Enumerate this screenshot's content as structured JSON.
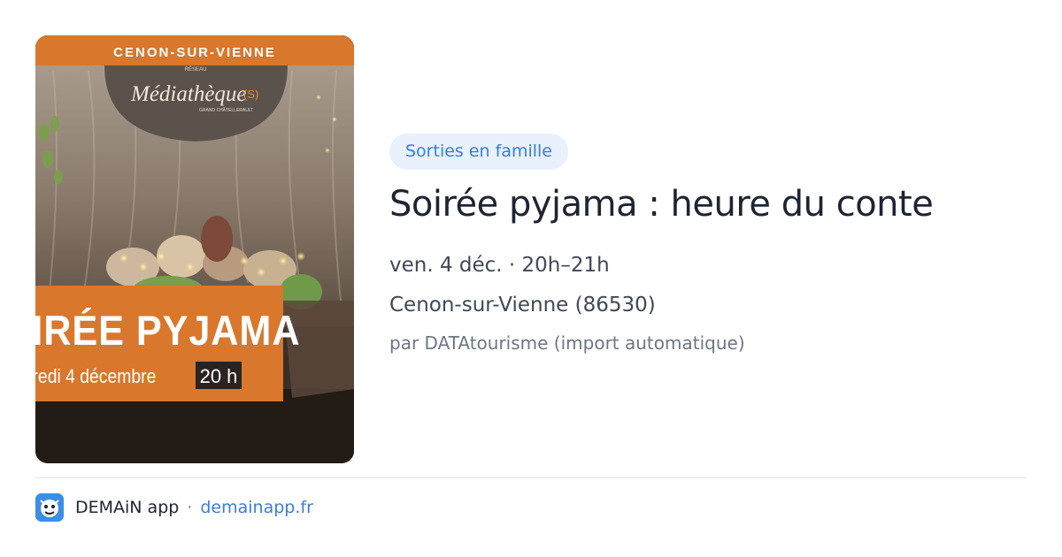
{
  "poster": {
    "town": "CENON-SUR-VIENNE",
    "network": "RÉSEAU",
    "library": "Médiathèque",
    "library_suffix": "(S)",
    "library_sub": "GRAND CHÂTELLERAULT",
    "headline": "IRÉE PYJAMA",
    "date_text": "redi 4 décembre",
    "time_text": "20 h",
    "colors": {
      "orange": "#d9772c",
      "dark_circle": "#5a524b"
    }
  },
  "event": {
    "category": "Sorties en famille",
    "title": "Soirée pyjama : heure du conte",
    "when": "ven. 4 déc. · 20h–21h",
    "where": "Cenon-sur-Vienne (86530)",
    "source": "par DATAtourisme (import automatique)"
  },
  "footer": {
    "app_name": "DEMAiN app",
    "separator": "·",
    "site": "demainapp.fr",
    "icon": "demain-app-icon"
  },
  "colors": {
    "accent": "#3b7dd8",
    "badge_bg": "#e8f1fc",
    "title": "#1d2433"
  }
}
